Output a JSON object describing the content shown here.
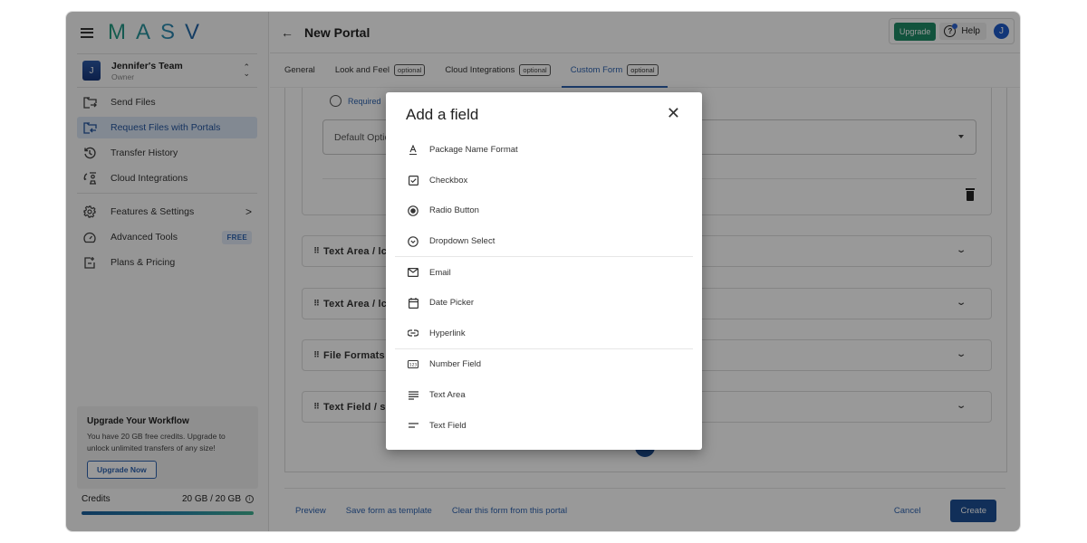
{
  "sidebar": {
    "logo": "MASV",
    "team": {
      "initial": "J",
      "name": "Jennifer's Team",
      "role": "Owner"
    },
    "nav": [
      {
        "label": "Send Files",
        "icon": "send-files-icon",
        "active": false
      },
      {
        "label": "Request Files with Portals",
        "icon": "request-files-icon",
        "active": true
      },
      {
        "label": "Transfer History",
        "icon": "history-icon",
        "active": false
      },
      {
        "label": "Cloud Integrations",
        "icon": "cloud-integrations-icon",
        "active": false
      }
    ],
    "nav2": [
      {
        "label": "Features & Settings",
        "icon": "gear-icon",
        "suffix": ">"
      },
      {
        "label": "Advanced Tools",
        "icon": "speedometer-icon",
        "badge": "FREE"
      },
      {
        "label": "Plans & Pricing",
        "icon": "plans-icon"
      }
    ],
    "upgrade_card": {
      "title": "Upgrade Your Workflow",
      "text": "You have 20 GB free credits. Upgrade to unlock unlimited transfers of any size!",
      "button": "Upgrade Now"
    },
    "credits": {
      "label": "Credits",
      "value": "20 GB / 20 GB",
      "fill_percent": 100
    }
  },
  "header": {
    "title": "New Portal",
    "upgrade_label": "Upgrade",
    "help_label": "Help",
    "user_initial": "J",
    "colors": {
      "upgrade": "#1f8a66",
      "primary": "#1d4f94",
      "accent": "#2e63b0"
    }
  },
  "tabs": [
    {
      "label": "General",
      "badge": null,
      "active": false
    },
    {
      "label": "Look and Feel",
      "badge": "optional",
      "active": false
    },
    {
      "label": "Cloud Integrations",
      "badge": "optional",
      "active": false
    },
    {
      "label": "Custom Form",
      "badge": "optional",
      "active": true
    }
  ],
  "form": {
    "required_label": "Required",
    "default_option_placeholder": "Default Option",
    "rows": [
      {
        "label": "Text Area / lc"
      },
      {
        "label": "Text Area / lc"
      },
      {
        "label": "File Formats"
      },
      {
        "label": "Text Field / s"
      }
    ]
  },
  "footer": {
    "links": [
      "Preview",
      "Save form as template",
      "Clear this form from this portal"
    ],
    "cancel": "Cancel",
    "create": "Create"
  },
  "modal": {
    "title": "Add a field",
    "groups": [
      [
        {
          "label": "Package Name Format",
          "icon": "text-format-icon"
        },
        {
          "label": "Checkbox",
          "icon": "checkbox-icon"
        },
        {
          "label": "Radio Button",
          "icon": "radio-button-icon"
        },
        {
          "label": "Dropdown Select",
          "icon": "dropdown-circle-icon"
        }
      ],
      [
        {
          "label": "Email",
          "icon": "email-icon"
        },
        {
          "label": "Date Picker",
          "icon": "calendar-icon"
        },
        {
          "label": "Hyperlink",
          "icon": "link-icon"
        }
      ],
      [
        {
          "label": "Number Field",
          "icon": "number-icon"
        },
        {
          "label": "Text Area",
          "icon": "text-area-icon"
        },
        {
          "label": "Text Field",
          "icon": "text-field-icon"
        }
      ]
    ]
  }
}
